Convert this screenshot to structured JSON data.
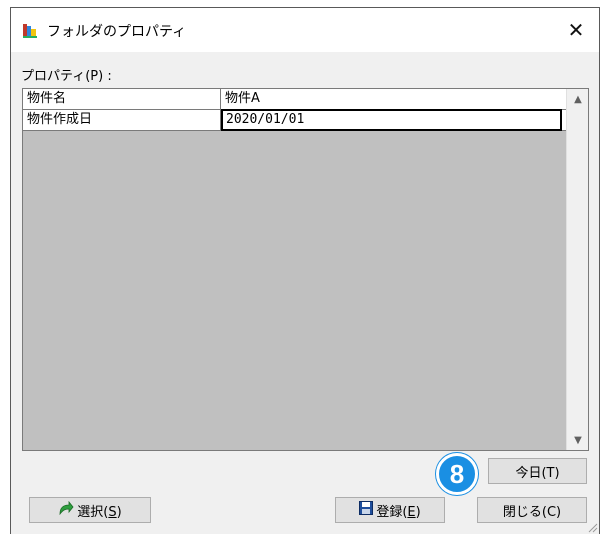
{
  "window": {
    "title": "フォルダのプロパティ",
    "close_glyph": "✕"
  },
  "properties": {
    "label": "プロパティ(P) :",
    "rows": [
      {
        "name": "物件名",
        "value": "物件A"
      },
      {
        "name": "物件作成日",
        "value": "2020/01/01"
      }
    ],
    "scroll_up_glyph": "▲",
    "scroll_down_glyph": "▼"
  },
  "buttons": {
    "today": "今日(T)",
    "close": "閉じる(C)",
    "register_text": "登録(",
    "register_key": "E",
    "register_tail": ")",
    "select_text": "選択(",
    "select_key": "S",
    "select_tail": ")"
  },
  "annotation": {
    "step_number": "8",
    "color": "#1a8fe3"
  },
  "icons": {
    "app": "folder-properties-icon",
    "save": "floppy-disk-icon",
    "select": "green-arrow-icon"
  }
}
